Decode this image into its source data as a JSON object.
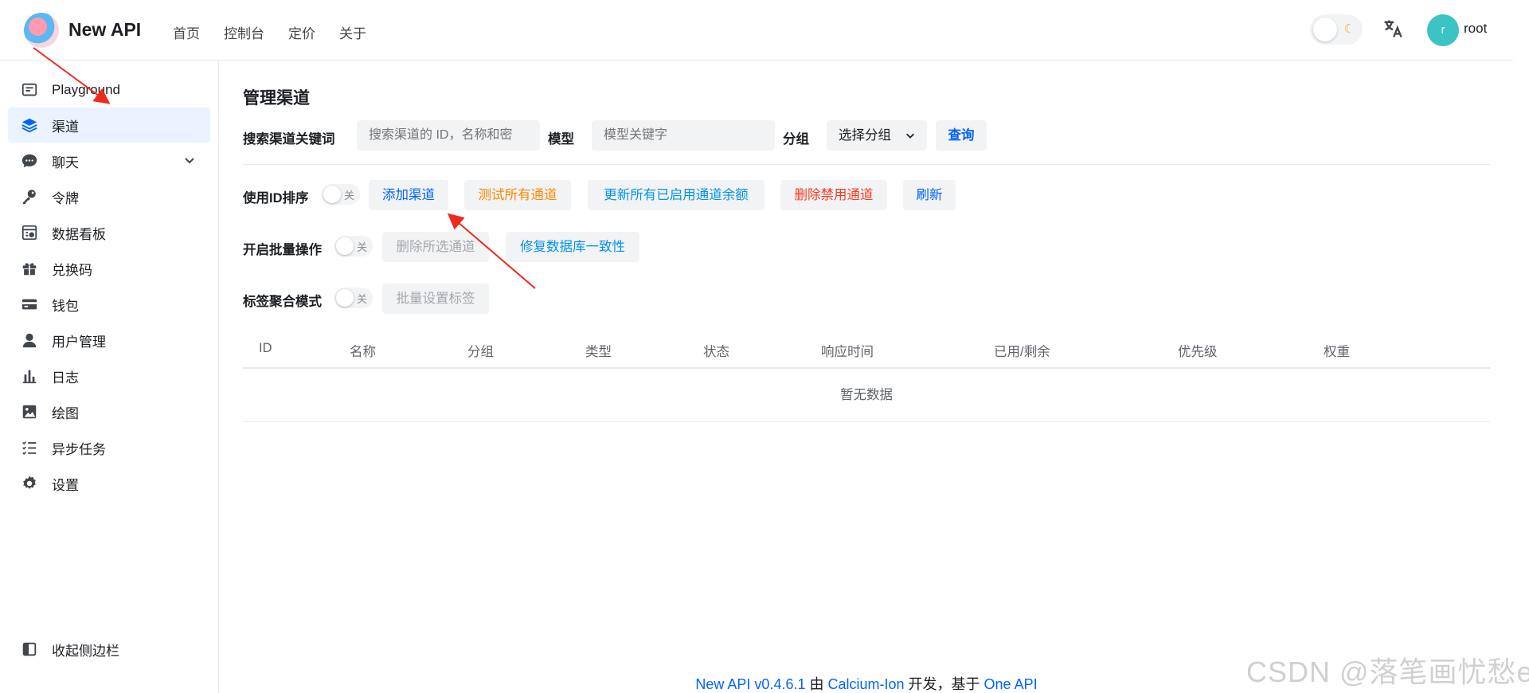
{
  "header": {
    "app_name": "New API",
    "nav": [
      "首页",
      "控制台",
      "定价",
      "关于"
    ],
    "theme_icon": "moon-icon",
    "lang_icon": "translate-icon",
    "avatar_letter": "r",
    "username": "root",
    "avatar_color": "#3cc3c3"
  },
  "sidebar": {
    "items": [
      {
        "label": "Playground",
        "icon": "playground-icon"
      },
      {
        "label": "渠道",
        "icon": "layers-icon",
        "active": true
      },
      {
        "label": "聊天",
        "icon": "chat-icon",
        "expandable": true
      },
      {
        "label": "令牌",
        "icon": "key-icon"
      },
      {
        "label": "数据看板",
        "icon": "dashboard-icon"
      },
      {
        "label": "兑换码",
        "icon": "gift-icon"
      },
      {
        "label": "钱包",
        "icon": "wallet-icon"
      },
      {
        "label": "用户管理",
        "icon": "user-icon"
      },
      {
        "label": "日志",
        "icon": "bar-chart-icon"
      },
      {
        "label": "绘图",
        "icon": "image-icon"
      },
      {
        "label": "异步任务",
        "icon": "task-list-icon"
      },
      {
        "label": "设置",
        "icon": "gear-icon"
      }
    ],
    "collapse_label": "收起侧边栏"
  },
  "main": {
    "title": "管理渠道",
    "search": {
      "keyword_label": "搜索渠道关键词",
      "keyword_placeholder": "搜索渠道的 ID，名称和密",
      "model_label": "模型",
      "model_placeholder": "模型关键字",
      "group_label": "分组",
      "group_select": "选择分组",
      "query_button": "查询"
    },
    "row1": {
      "label": "使用ID排序",
      "switch_off": "关",
      "buttons": [
        "添加渠道",
        "测试所有通道",
        "更新所有已启用通道余额",
        "删除禁用通道",
        "刷新"
      ]
    },
    "row2": {
      "label": "开启批量操作",
      "switch_off": "关",
      "buttons": [
        "删除所选通道",
        "修复数据库一致性"
      ]
    },
    "row3": {
      "label": "标签聚合模式",
      "switch_off": "关",
      "buttons": [
        "批量设置标签"
      ]
    },
    "table": {
      "headers": [
        "ID",
        "名称",
        "分组",
        "类型",
        "状态",
        "响应时间",
        "已用/剩余",
        "优先级",
        "权重"
      ],
      "empty_text": "暂无数据"
    },
    "footer": {
      "part1": "New API v0.4.6.1",
      "part2": " 由 ",
      "part3": "Calcium-Ion",
      "part4": " 开发，基于 ",
      "part5": "One API"
    }
  },
  "watermark": "CSDN @落笔画忧愁e",
  "colors": {
    "primary": "#0064fa",
    "warning": "#fc8800",
    "info": "#0095ee",
    "danger": "#f93920",
    "active_bg": "#eaf3ff"
  }
}
